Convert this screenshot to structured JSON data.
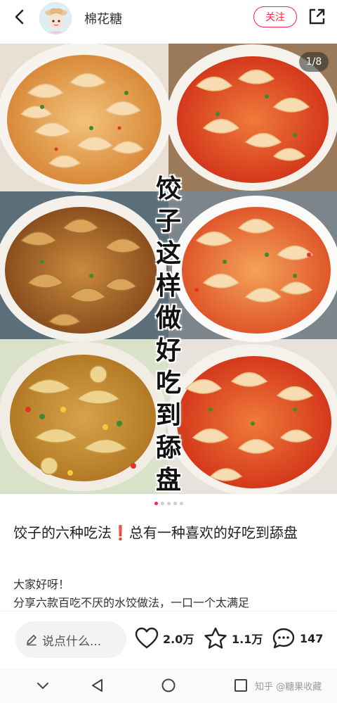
{
  "header": {
    "author_name": "棉花糖",
    "follow_label": "关注"
  },
  "image": {
    "counter": "1/8",
    "overlay_chars": [
      "饺",
      "子",
      "这",
      "样",
      "做",
      "好",
      "吃",
      "到",
      "舔",
      "盘"
    ],
    "page_dots": 5,
    "active_dot": 0
  },
  "post": {
    "title": "饺子的六种吃法❗总有一种喜欢的好吃到舔盘",
    "body_line1": "大家好呀！",
    "body_line2": "分享六款百吃不厌的水饺做法，一口一个太满足"
  },
  "actions": {
    "comment_placeholder": "说点什么...",
    "likes": "2.0万",
    "favorites": "1.1万",
    "comments": "147"
  },
  "watermark": "知乎 @糖果收藏",
  "colors": {
    "accent": "#ff2442"
  }
}
